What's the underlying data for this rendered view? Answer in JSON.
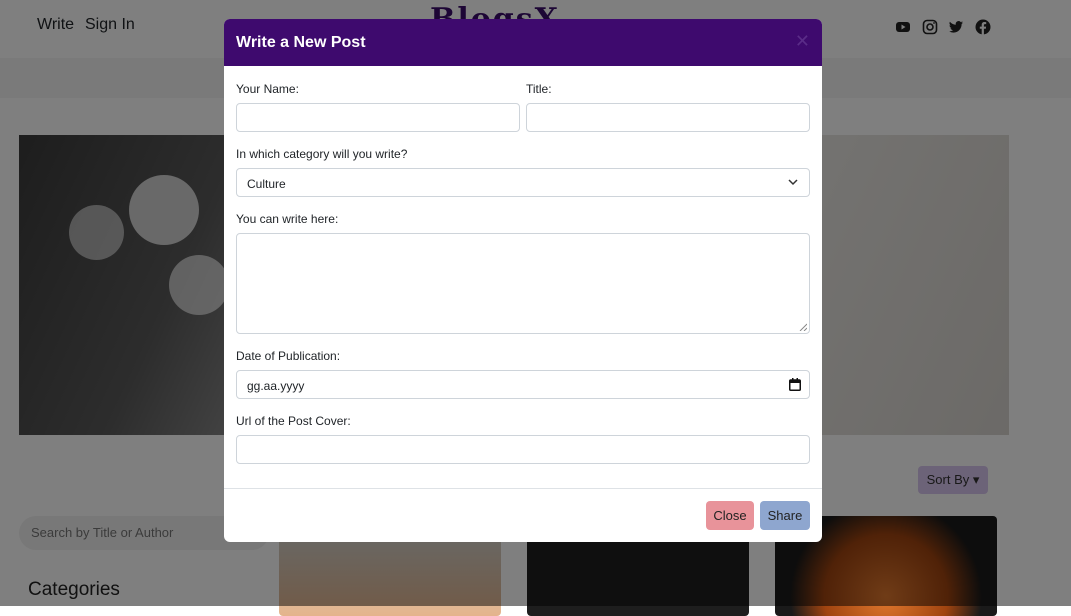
{
  "nav": {
    "write": "Write",
    "sign_in": "Sign In",
    "logo": "BlogsX",
    "social_icons": [
      "youtube-icon",
      "instagram-icon",
      "twitter-icon",
      "facebook-icon"
    ]
  },
  "page": {
    "sort_label": "Sort By",
    "search_placeholder": "Search by Title or Author",
    "categories_heading": "Categories"
  },
  "modal": {
    "title": "Write a New Post",
    "name_label": "Your Name:",
    "name_value": "",
    "title_label": "Title:",
    "title_value": "",
    "category_label": "In which category will you write?",
    "category_selected": "Culture",
    "content_label": "You can write here:",
    "content_value": "",
    "date_label": "Date of Publication:",
    "date_value": "gg.aa.yyyy",
    "cover_label": "Url of the Post Cover:",
    "cover_value": "",
    "close_label": "Close",
    "share_label": "Share"
  },
  "colors": {
    "header_bg": "#3e0a6e",
    "close_btn": "#e8939a",
    "share_btn": "#8ea6cf",
    "sort_btn": "#d9c6f0"
  }
}
